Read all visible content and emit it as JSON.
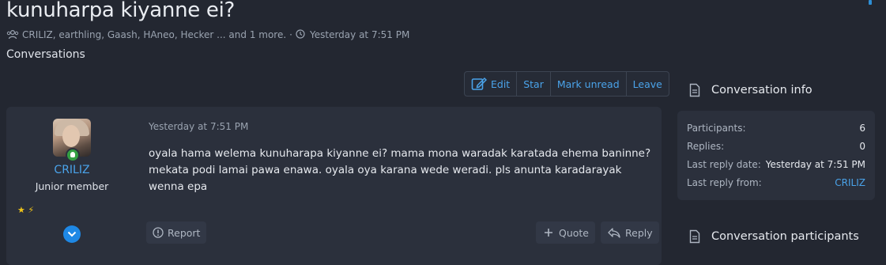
{
  "thread": {
    "title": "kunuharpa kiyanne ei?",
    "participants_text": "CRILIZ, earthling, Gaash, HAneo, Hecker ... and 1 more.",
    "separator": "·",
    "date": "Yesterday at 7:51 PM",
    "breadcrumb": "Conversations"
  },
  "actions": {
    "edit": "Edit",
    "star": "Star",
    "mark_unread": "Mark unread",
    "leave": "Leave"
  },
  "message": {
    "username": "CRILIZ",
    "user_title": "Junior member",
    "date": "Yesterday at 7:51 PM",
    "body": "oyala hama welema kunuharapa kiyanne ei? mama mona waradak karatada ehema baninne? mekata podi lamai pawa enawa. oyala oya karana wede weradi. pls anunta karadarayak wenna epa",
    "report": "Report",
    "quote": "Quote",
    "reply": "Reply"
  },
  "sidebar": {
    "info_title": "Conversation info",
    "rows": [
      {
        "label": "Participants:",
        "value": "6"
      },
      {
        "label": "Replies:",
        "value": "0"
      },
      {
        "label": "Last reply date:",
        "value": "Yesterday at 7:51 PM"
      },
      {
        "label": "Last reply from:",
        "value": "CRILIZ"
      }
    ],
    "participants_title": "Conversation participants"
  },
  "colors": {
    "background": "#232731",
    "card": "#2b303c",
    "accent": "#4aa3ea",
    "online": "#34a043"
  }
}
